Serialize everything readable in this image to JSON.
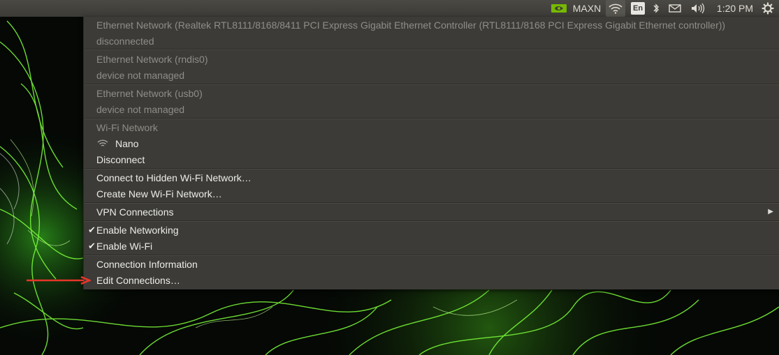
{
  "panel": {
    "nvidia_icon": "nvidia-logo-icon",
    "power_mode": "MAXN",
    "wifi_icon": "wifi-icon",
    "language": "En",
    "bluetooth_icon": "bluetooth-icon",
    "mail_icon": "mail-icon",
    "volume_icon": "volume-icon",
    "time": "1:20 PM",
    "settings_icon": "gear-icon"
  },
  "menu": {
    "ethernet_realtek": {
      "title": "Ethernet Network (Realtek RTL8111/8168/8411 PCI Express Gigabit Ethernet Controller (RTL8111/8168 PCI Express Gigabit Ethernet controller))",
      "status": "disconnected"
    },
    "ethernet_rndis": {
      "title": "Ethernet Network (rndis0)",
      "status": "device not managed"
    },
    "ethernet_usb": {
      "title": "Ethernet Network (usb0)",
      "status": "device not managed"
    },
    "wifi": {
      "header": "Wi-Fi Network",
      "network_name": "Nano",
      "disconnect_label": "Disconnect"
    },
    "connect_hidden": "Connect to Hidden Wi-Fi Network…",
    "create_new": "Create New Wi-Fi Network…",
    "vpn": "VPN Connections",
    "enable_networking": "Enable Networking",
    "enable_networking_checked": true,
    "enable_wifi": "Enable Wi-Fi",
    "enable_wifi_checked": true,
    "connection_info": "Connection Information",
    "edit_connections": "Edit Connections…"
  },
  "colors": {
    "panel": "#3c3b37",
    "menu_bg": "#3c3b37",
    "text": "#ececea",
    "text_dim": "#8f8d88",
    "annotation_arrow": "#e8352a"
  }
}
